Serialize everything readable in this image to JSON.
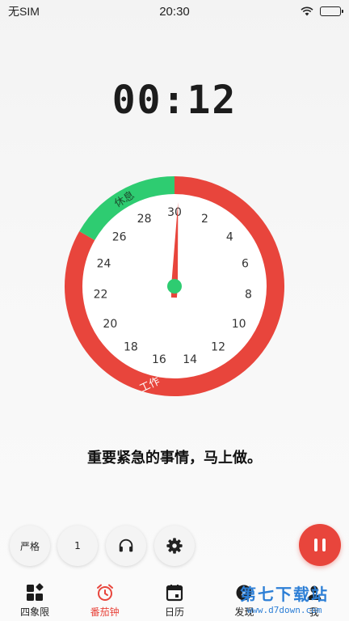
{
  "status_bar": {
    "carrier": "无SIM",
    "time": "20:30",
    "battery_level": 1.0
  },
  "timer": {
    "display": "00:12"
  },
  "clock": {
    "labels": [
      "30",
      "2",
      "4",
      "6",
      "8",
      "10",
      "12",
      "14",
      "16",
      "18",
      "20",
      "22",
      "24",
      "26",
      "28"
    ],
    "segments": [
      {
        "label": "工作",
        "color": "#e8453c",
        "start_min": 0,
        "end_min": 25
      },
      {
        "label": "休息",
        "color": "#2ecc71",
        "start_min": 25,
        "end_min": 30
      }
    ],
    "hand_color": "#e8453c",
    "hub_color": "#2ecc71",
    "hand_minute": 0.2
  },
  "motto": "重要紧急的事情，马上做。",
  "controls": {
    "strict_label": "严格",
    "count_label": "1",
    "sound_icon": "headphones-icon",
    "settings_icon": "gear-icon",
    "pause_icon": "pause-icon",
    "accent": "#e8453c"
  },
  "tabs": [
    {
      "label": "四象限",
      "icon": "quadrant-icon",
      "active": false
    },
    {
      "label": "番茄钟",
      "icon": "alarm-clock-icon",
      "active": true
    },
    {
      "label": "日历",
      "icon": "calendar-icon",
      "active": false
    },
    {
      "label": "发现",
      "icon": "compass-icon",
      "active": false
    },
    {
      "label": "我",
      "icon": "user-icon",
      "active": false
    }
  ],
  "watermark": {
    "title": "第七下载站",
    "url": "www.d7down.com"
  }
}
